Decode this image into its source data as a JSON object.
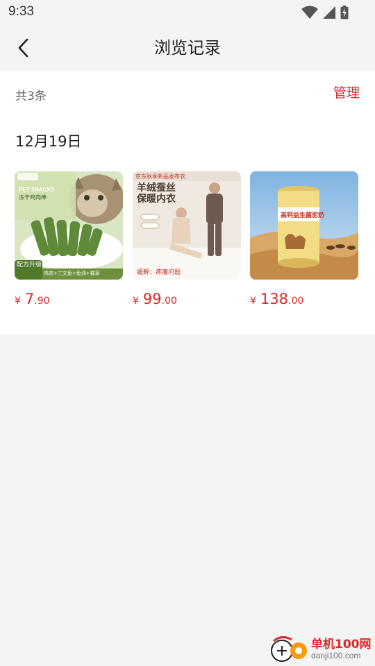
{
  "status_bar": {
    "time": "9:33"
  },
  "header": {
    "title": "浏览记录"
  },
  "summary": {
    "count_text": "共3条",
    "manage_label": "管理"
  },
  "group": {
    "date": "12月19日",
    "products": [
      {
        "currency": "¥",
        "price_int": "7",
        "price_dec": ".90",
        "image": {
          "badge": "配方升级",
          "brand_text": "PET SNACKS",
          "subtitle": "冻干鸡肉棒",
          "bottom_text": "鸡肉+三文鱼+鱼油+猫草"
        }
      },
      {
        "currency": "¥",
        "price_int": "99",
        "price_dec": ".00",
        "image": {
          "top_banner": "京东秋季新品发布衣",
          "headline1": "羊绒蚕丝",
          "headline2": "保暖内衣",
          "bottom_text": "缓解：疼痛问题"
        }
      },
      {
        "currency": "¥",
        "price_int": "138",
        "price_dec": ".00",
        "image": {
          "can_label": "高钙益生菌驼奶"
        }
      }
    ]
  },
  "watermark": {
    "line1": "单机100网",
    "line2": "danji100.com"
  },
  "colors": {
    "accent": "#e0262b",
    "page_bg": "#f4f4f4"
  }
}
